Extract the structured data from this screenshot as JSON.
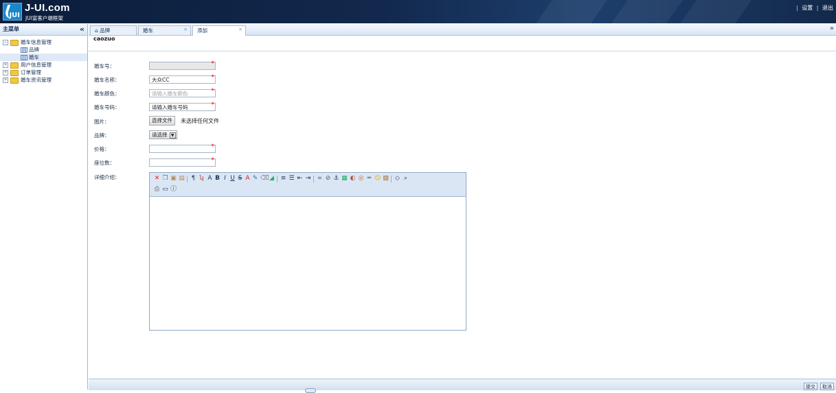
{
  "header": {
    "brand": "J-UI.com",
    "brand_sub": "JUI富客户端框架",
    "logo_letters": "JUI",
    "links": [
      "设置",
      "退出"
    ]
  },
  "sidebar": {
    "title": "主菜单",
    "collapse_icon": "«",
    "tree": [
      {
        "label": "婚车信息管理",
        "expanded": true,
        "children": [
          "品牌",
          "婚车"
        ],
        "selected_child": "婚车"
      },
      {
        "label": "用户信息管理",
        "expanded": false
      },
      {
        "label": "订单管理",
        "expanded": false
      },
      {
        "label": "婚车资讯管理",
        "expanded": false
      }
    ]
  },
  "tabs": [
    {
      "label": "品牌",
      "icon": "home-icon",
      "closable": false
    },
    {
      "label": "婚车",
      "closable": true
    },
    {
      "label": "添加",
      "closable": true,
      "active": true
    }
  ],
  "tabs_more_icon": "»",
  "page": {
    "title": "caozuo",
    "fields": {
      "car_no": {
        "label": "婚车号：",
        "value": "",
        "disabled": true
      },
      "car_name": {
        "label": "婚车名称：",
        "value": "大众CC"
      },
      "car_color": {
        "label": "婚车颜色：",
        "placeholder": "请输入婚车颜色"
      },
      "car_plate": {
        "label": "婚车号码：",
        "value": "请输入婚车号码"
      },
      "image": {
        "label": "图片：",
        "button": "选择文件",
        "status": "未选择任何文件"
      },
      "brand": {
        "label": "品牌：",
        "selected": "请选择"
      },
      "price": {
        "label": "价格：",
        "value": ""
      },
      "seats": {
        "label": "座位数：",
        "value": ""
      },
      "description": {
        "label": "详细介绍：",
        "value": ""
      }
    },
    "required_mark": "*"
  },
  "footer": {
    "submit": "提交",
    "cancel": "取消"
  },
  "colors": {
    "header_bg": "#12284c",
    "panel_bg": "#d8e5f4",
    "required": "#ee0000"
  }
}
